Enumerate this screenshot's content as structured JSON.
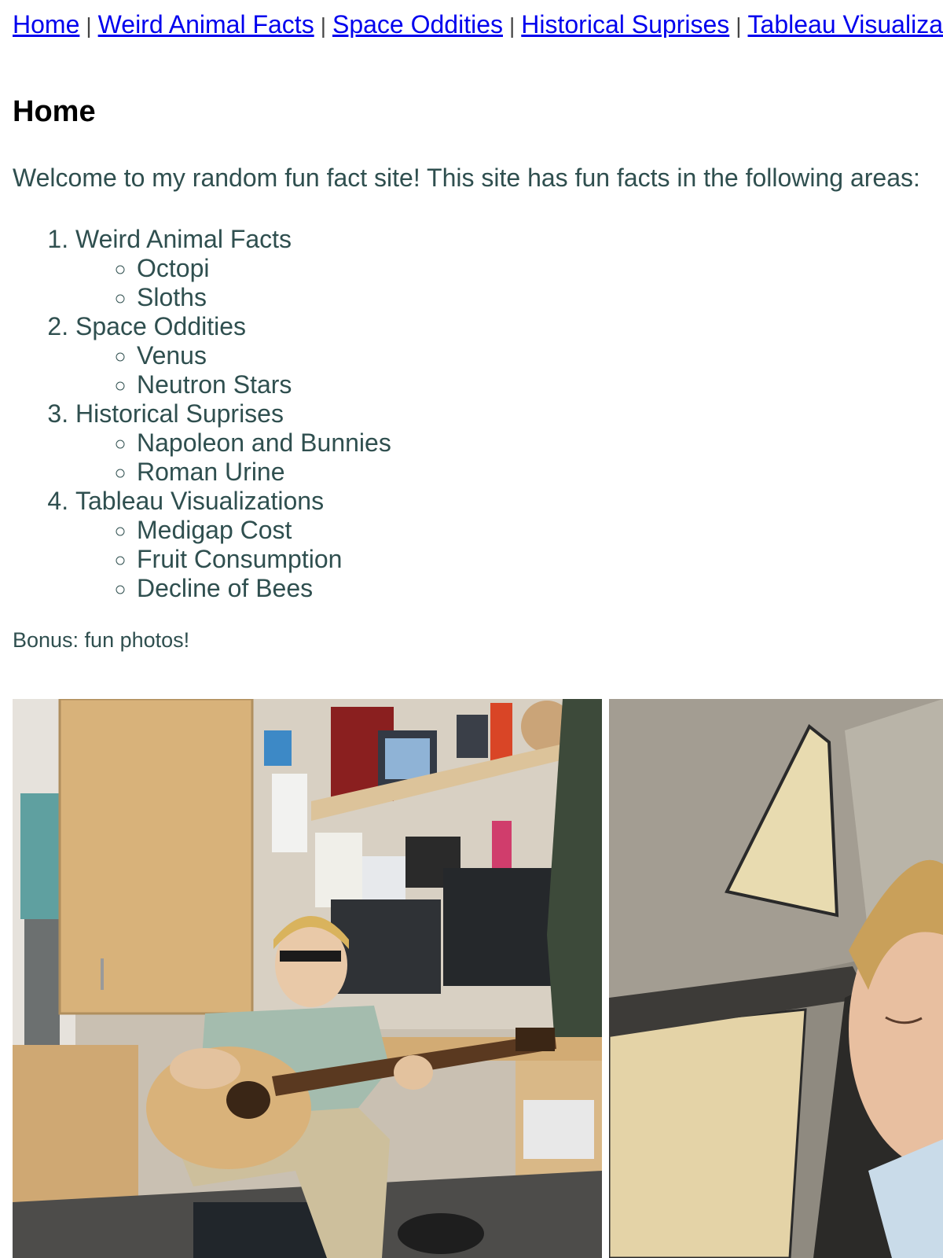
{
  "nav": {
    "links": [
      {
        "label": "Home"
      },
      {
        "label": "Weird Animal Facts"
      },
      {
        "label": "Space Oddities"
      },
      {
        "label": "Historical Suprises"
      },
      {
        "label": "Tableau Visualizations"
      }
    ],
    "separator": "|"
  },
  "page": {
    "title": "Home",
    "intro": "Welcome to my random fun fact site! This site has fun facts in the following areas:",
    "bonus": "Bonus: fun photos!"
  },
  "topics": [
    {
      "label": "Weird Animal Facts",
      "items": [
        "Octopi",
        "Sloths"
      ]
    },
    {
      "label": "Space Oddities",
      "items": [
        "Venus",
        "Neutron Stars"
      ]
    },
    {
      "label": "Historical Suprises",
      "items": [
        "Napoleon and Bunnies",
        "Roman Urine"
      ]
    },
    {
      "label": "Tableau Visualizations",
      "items": [
        "Medigap Cost",
        "Fruit Consumption",
        "Decline of Bees"
      ]
    }
  ],
  "photos": [
    {
      "name": "guitar-dorm-photo"
    },
    {
      "name": "car-selfie-photo"
    }
  ],
  "colors": {
    "link": "#0000ee",
    "body_text": "#2f4f4f",
    "heading": "#000000",
    "background": "#ffffff"
  }
}
